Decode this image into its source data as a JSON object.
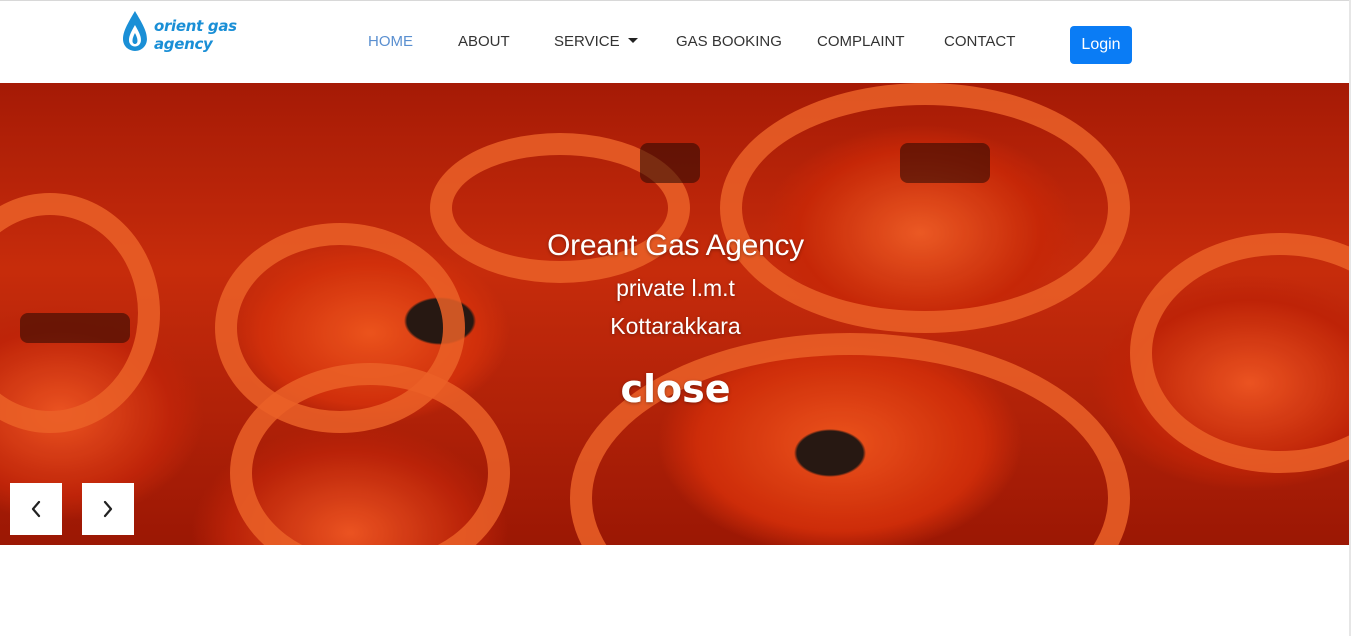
{
  "brand": {
    "logo_text": "orient gas agency",
    "logo_icon": "flame-drop-icon",
    "color": "#1a8fd6"
  },
  "nav": {
    "items": [
      {
        "label": "HOME",
        "active": true
      },
      {
        "label": "ABOUT",
        "active": false
      },
      {
        "label": "SERVICE",
        "active": false,
        "dropdown": true
      },
      {
        "label": "GAS BOOKING",
        "active": false
      },
      {
        "label": "COMPLAINT",
        "active": false
      },
      {
        "label": "CONTACT",
        "active": false
      }
    ],
    "login_label": "Login",
    "active_color": "#5a8fd0",
    "login_color": "#0a7cf5"
  },
  "hero": {
    "title": "Oreant Gas Agency",
    "subtitle_1": "private l.m.t",
    "subtitle_2": "Kottarakkara",
    "close_label": "close",
    "prev_icon": "chevron-left-icon",
    "next_icon": "chevron-right-icon",
    "background_color": "#d8300d"
  }
}
